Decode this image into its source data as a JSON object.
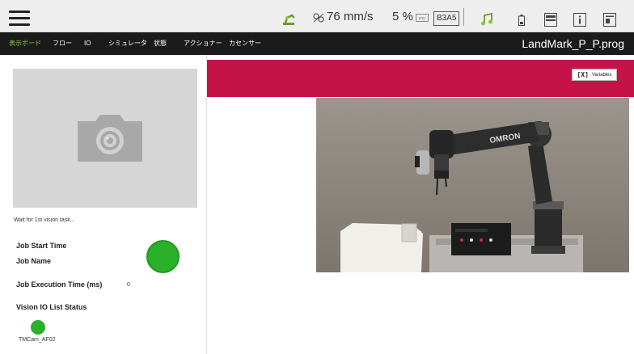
{
  "topbar": {
    "speed": "76 mm/s",
    "percent": "5 %",
    "robot_id": "B3A5",
    "icons": [
      "menu-icon",
      "robot-arm-icon",
      "speed-icon",
      "percent-icon",
      "music-note-icon",
      "battery-icon",
      "display-icon",
      "info-icon",
      "document-icon"
    ]
  },
  "nav": {
    "items": [
      "表示ボード",
      "フロー",
      "IO",
      "シミュレータ",
      "状態",
      "アクショナー",
      "カセンサー"
    ],
    "active_index": 0,
    "program_name": "LandMark_P_P.prog"
  },
  "left": {
    "wait_text": "Wait for 1st vision task...",
    "job_start_time_label": "Job Start Time",
    "job_name_label": "Job Name",
    "job_exec_label": "Job Execution Time (ms)",
    "job_exec_value": "0",
    "vision_io_label": "Vision IO List Status",
    "camera_name": "TMCam_AF02"
  },
  "right": {
    "variables_icon_text": "[X]",
    "variables_label": "Variables",
    "banner_color": "#c5134a"
  },
  "colors": {
    "status_ok": "#2bb02b",
    "nav_active": "#8ec63f",
    "nav_bg": "#1b1b1b"
  }
}
